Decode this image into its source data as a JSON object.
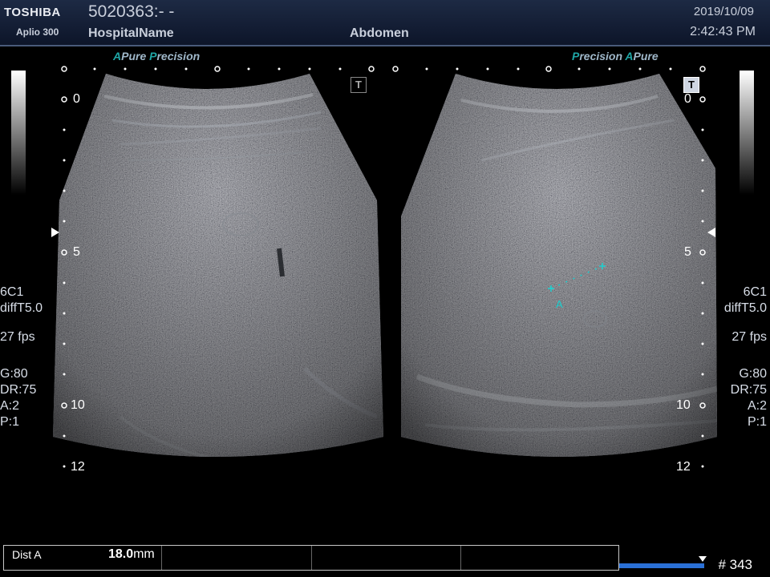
{
  "header": {
    "brand": "TOSHIBA",
    "model": "Aplio 300",
    "patient_id": "5020363:- -",
    "hospital": "HospitalName",
    "exam": "Abdomen",
    "date": "2019/10/09",
    "time": "2:42:43 PM"
  },
  "logos": {
    "left": {
      "a": "A",
      "pure": "Pure",
      "p": "P",
      "recision": "recision"
    },
    "right": {
      "p": "P",
      "recision": "recision",
      "a": "A",
      "pure": "Pure"
    }
  },
  "left_panel": {
    "probe": "6C1",
    "mode": "diffT5.0",
    "fps": "27 fps",
    "gain": "G:80",
    "dr": "DR:75",
    "a": "A:2",
    "p": "P:1",
    "depth_labels": [
      "0",
      "5",
      "10",
      "12"
    ]
  },
  "right_panel": {
    "probe": "6C1",
    "mode": "diffT5.0",
    "fps": "27 fps",
    "gain": "G:80",
    "dr": "DR:75",
    "a": "A:2",
    "p": "P:1",
    "depth_labels": [
      "0",
      "5",
      "10",
      "12"
    ]
  },
  "t_button": "T",
  "measurement": {
    "marker": "A",
    "label": "Dist A",
    "value": "18.0",
    "unit": "mm"
  },
  "cine": {
    "count": "# 343"
  },
  "colors": {
    "accent_teal": "#1fa6a6",
    "cine_blue": "#2a70d6",
    "header_bg": "#1d2a44"
  }
}
